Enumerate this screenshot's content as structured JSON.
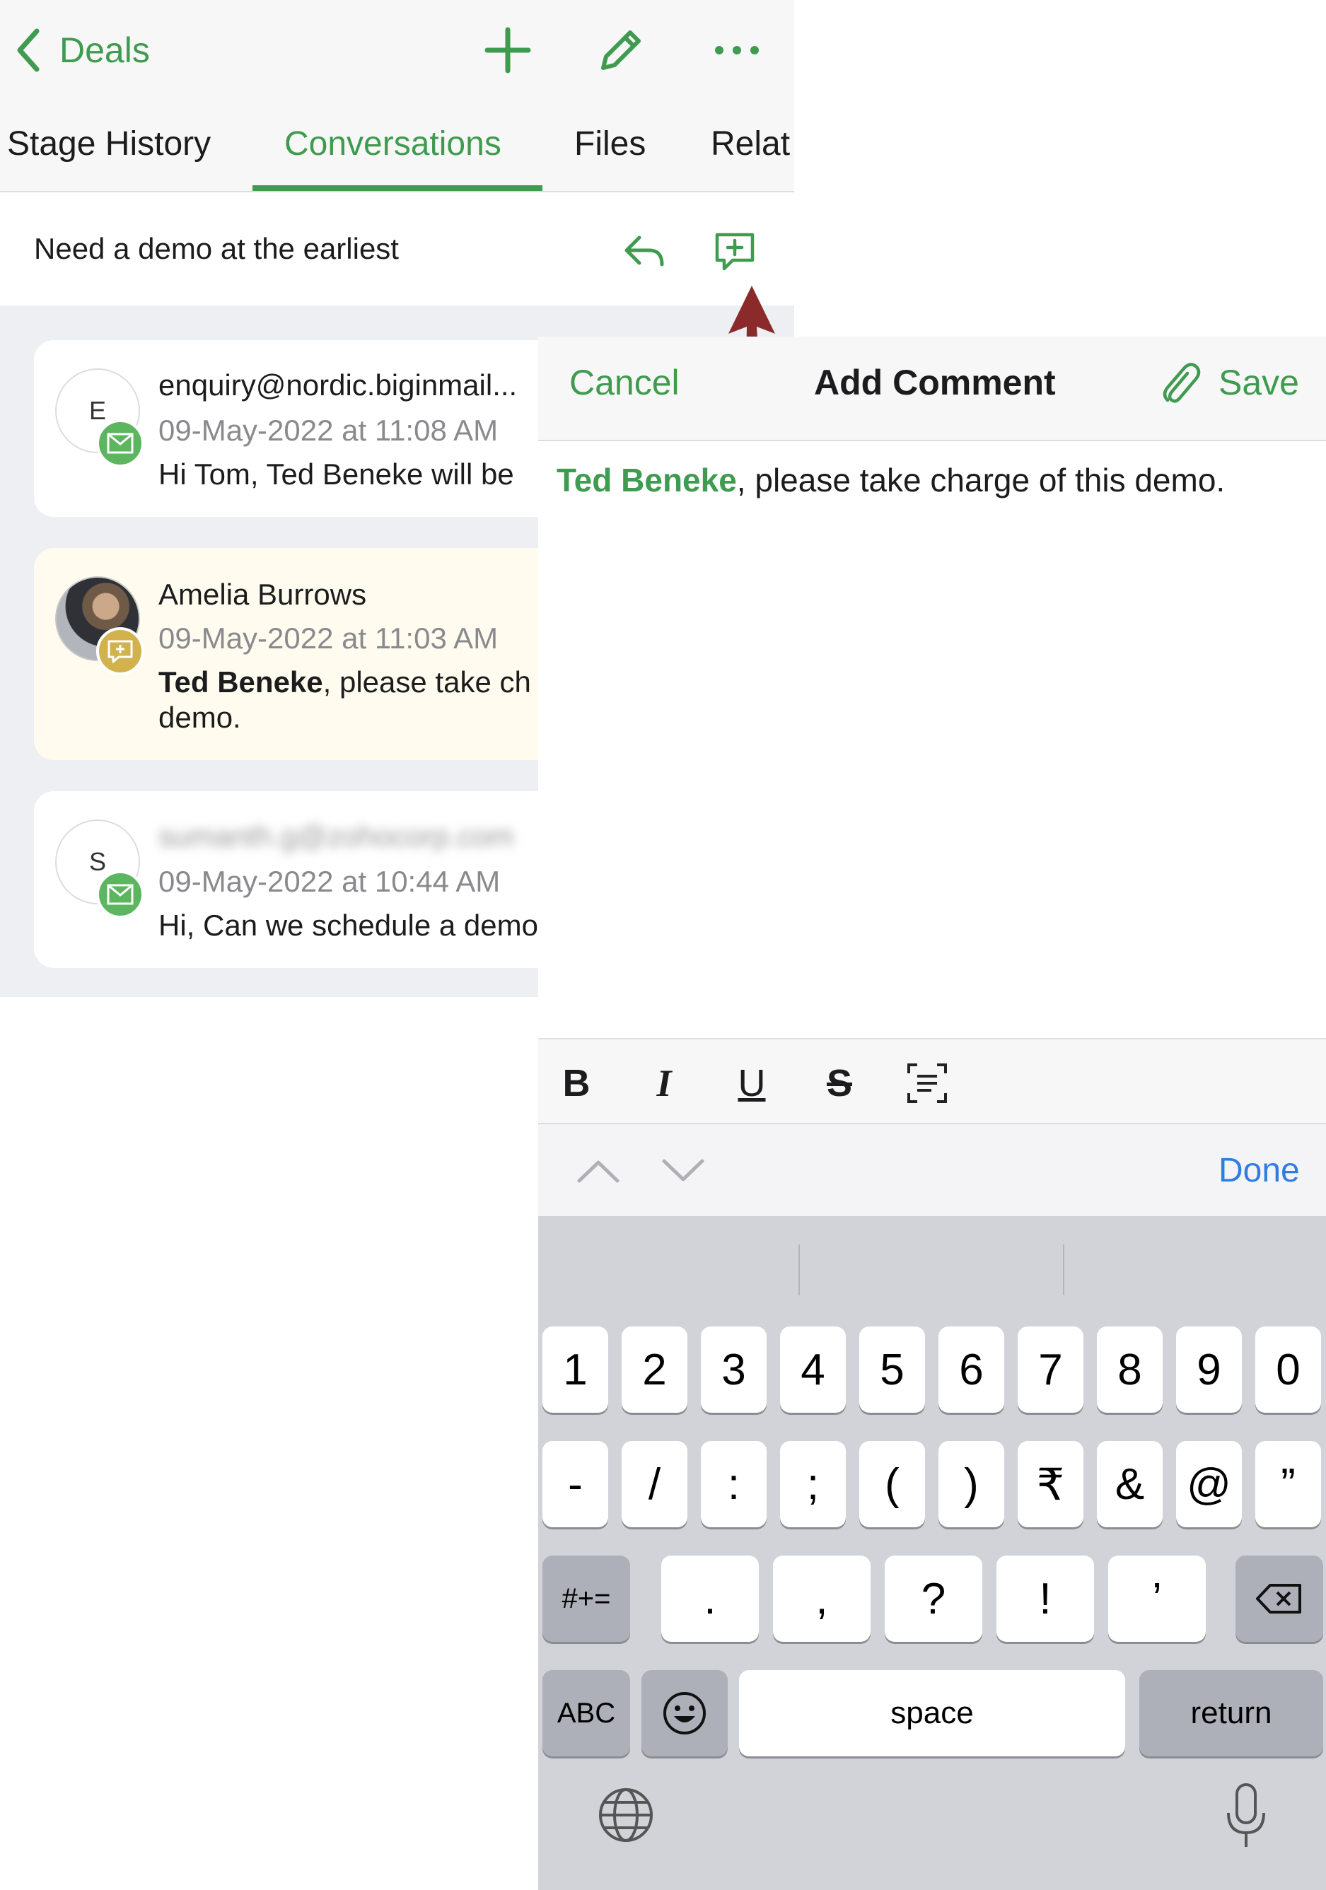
{
  "nav": {
    "back_label": "Deals"
  },
  "tabs": [
    {
      "label": "Stage History"
    },
    {
      "label": "Conversations"
    },
    {
      "label": "Files"
    },
    {
      "label": "Relat"
    }
  ],
  "subject": "Need a demo at the earliest",
  "conversations": [
    {
      "initial": "E",
      "from": "enquiry@nordic.biginmail...",
      "date": "09-May-2022 at 11:08 AM",
      "body": "Hi Tom, Ted Beneke will be",
      "type": "email"
    },
    {
      "from": "Amelia Burrows",
      "date": "09-May-2022 at 11:03 AM",
      "body_mention": "Ted Beneke",
      "body_rest": ", please take ch",
      "body_line2": "demo.",
      "type": "comment"
    },
    {
      "initial": "S",
      "from": "sumanth.g@zohocorp.com",
      "date": "09-May-2022 at 10:44 AM",
      "body": "Hi, Can we schedule a demo",
      "type": "email"
    }
  ],
  "sheet": {
    "cancel_label": "Cancel",
    "title": "Add Comment",
    "save_label": "Save",
    "comment_mention": "Ted Beneke",
    "comment_rest": ", please take charge of this demo."
  },
  "format_bar": {
    "bold": "B",
    "italic": "I",
    "underline": "U",
    "strike": "S"
  },
  "accessory": {
    "done_label": "Done"
  },
  "keyboard": {
    "row1": [
      "1",
      "2",
      "3",
      "4",
      "5",
      "6",
      "7",
      "8",
      "9",
      "0"
    ],
    "row2": [
      "-",
      "/",
      ":",
      ";",
      "(",
      ")",
      "₹",
      "&",
      "@",
      "”"
    ],
    "row3_mode": "#+=",
    "row3": [
      ".",
      ",",
      "?",
      "!",
      "’"
    ],
    "abc_label": "ABC",
    "space_label": "space",
    "return_label": "return"
  },
  "colors": {
    "accent": "#3f9b4f",
    "done": "#2f7de1",
    "arrow": "#8b2a2a",
    "comment_badge": "#d2b24d"
  },
  "icons": [
    "chevron-left-icon",
    "plus-icon",
    "pencil-icon",
    "more-icon",
    "reply-icon",
    "add-comment-icon",
    "email-icon",
    "comment-icon",
    "paperclip-icon",
    "text-format-icon",
    "chevron-up-icon",
    "chevron-down-icon",
    "delete-icon",
    "emoji-icon",
    "globe-icon",
    "microphone-icon"
  ]
}
